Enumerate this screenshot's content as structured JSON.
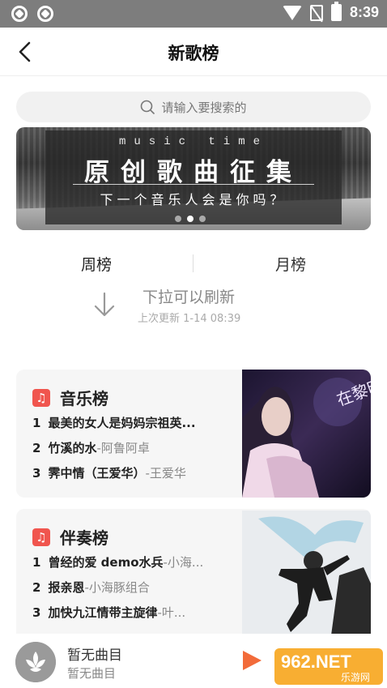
{
  "status_bar": {
    "time": "8:39",
    "icons": [
      "app-icon",
      "app-icon",
      "wifi-icon",
      "no-sim-icon",
      "battery-charging-icon"
    ]
  },
  "header": {
    "title": "新歌榜",
    "back_icon": "chevron-left-icon"
  },
  "search": {
    "placeholder": "请输入要搜索的"
  },
  "banner": {
    "top_text": "music time",
    "headline": "原创歌曲征集",
    "subline": "下一个音乐人会是你吗？",
    "dots": 3,
    "active_dot": 1
  },
  "tabs": [
    {
      "label": "周榜",
      "active": true
    },
    {
      "label": "月榜",
      "active": false
    }
  ],
  "refresh": {
    "title": "下拉可以刷新",
    "time": "上次更新 1-14 08:39"
  },
  "charts": [
    {
      "title": "音乐榜",
      "icon": "music-note-icon",
      "items": [
        {
          "rank": "1",
          "song": "最美的女人是妈妈宗祖英...",
          "artist": ""
        },
        {
          "rank": "2",
          "song": "竹溪的水",
          "artist": "-阿鲁阿卓"
        },
        {
          "rank": "3",
          "song": "霁中情（王爱华）",
          "artist": "-王爱华"
        }
      ],
      "image_caption": "在黎明之前"
    },
    {
      "title": "伴奏榜",
      "icon": "music-note-icon",
      "items": [
        {
          "rank": "1",
          "song": "曾经的爱 demo水兵",
          "artist": "-小海..."
        },
        {
          "rank": "2",
          "song": "报亲恩",
          "artist": "-小海豚组合"
        },
        {
          "rank": "3",
          "song": "加快九江情带主旋律",
          "artist": "-叶..."
        }
      ]
    }
  ],
  "player": {
    "title": "暂无曲目",
    "subtitle": "暂无曲目"
  },
  "watermark": {
    "brand": "962.NET",
    "sub": "乐游网"
  },
  "colors": {
    "accent": "#f0554e",
    "play": "#f26b3a",
    "status_bar": "#7d7d7d"
  }
}
